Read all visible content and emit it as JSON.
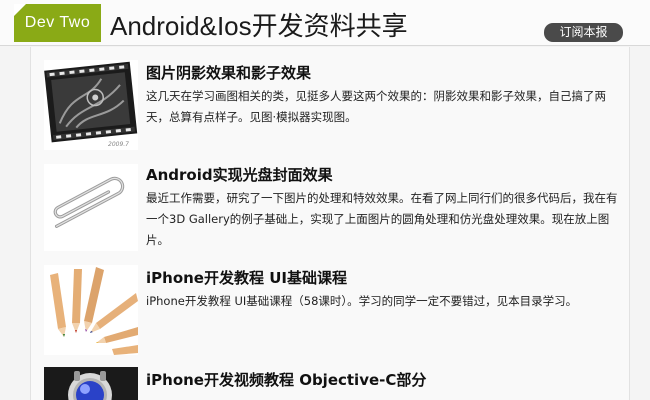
{
  "header": {
    "logo_text": "Dev Two",
    "site_title": "Android&Ios开发资料共享",
    "subscribe_label": "订阅本报",
    "colors": {
      "logo": "#8aaa16",
      "subscribe_bg": "#4a4a4a"
    }
  },
  "articles": [
    {
      "title": "图片阴影效果和影子效果",
      "body": "这几天在学习画图相关的类，见挺多人要这两个效果的：阴影效果和影子效果，自己搞了两天，总算有点样子。见图·模拟器实现图。",
      "thumb_icon": "film-frame-icon",
      "thumb_caption": "2009.7"
    },
    {
      "title": "Android实现光盘封面效果",
      "body": "最近工作需要，研究了一下图片的处理和特效效果。在看了网上同行们的很多代码后，我在有一个3D Gallery的例子基础上，实现了上面图片的圆角处理和仿光盘处理效果。现在放上图片。",
      "thumb_icon": "paperclip-icon"
    },
    {
      "title": "iPhone开发教程 UI基础课程",
      "body": "iPhone开发教程 UI基础课程（58课时）。学习的同学一定不要错过，见本目录学习。",
      "thumb_icon": "colored-pencils-icon"
    },
    {
      "title": "iPhone开发视频教程 Objective-C部分",
      "body": "",
      "thumb_icon": "blue-ball-icon"
    }
  ]
}
